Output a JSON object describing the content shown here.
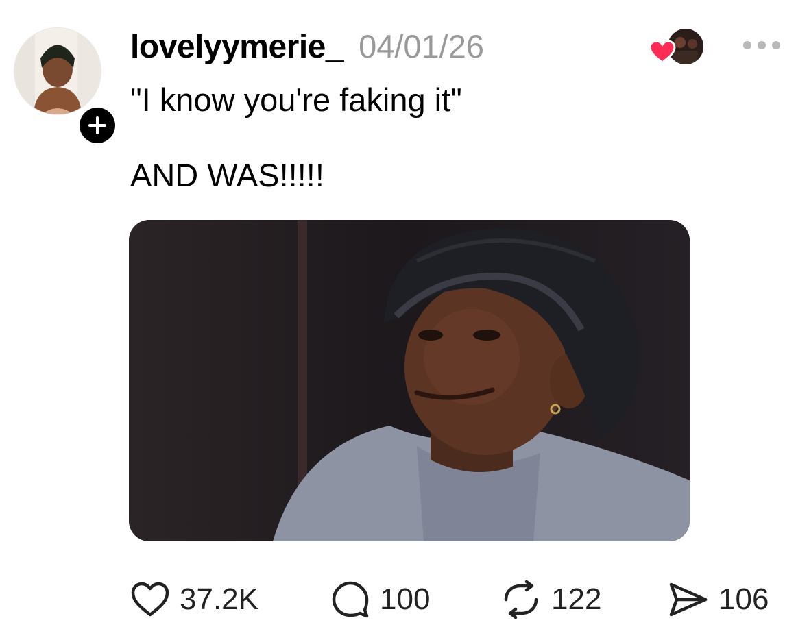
{
  "post": {
    "author": {
      "username": "lovelyymerie_",
      "follow_symbol": "+"
    },
    "timestamp": "04/01/26",
    "text_line1": "\"I know you're faking it\"",
    "text_line2": "AND WAS!!!!!",
    "media": {
      "type": "video-still",
      "icon": "image-media"
    },
    "liked_by": {
      "icon": "heart-icon",
      "color": "#ff2d55"
    },
    "menu": {
      "icon": "more-horizontal-icon"
    },
    "actions": {
      "likes": "37.2K",
      "replies": "100",
      "reposts": "122",
      "shares": "106"
    }
  },
  "colors": {
    "text": "#000000",
    "muted": "#999999",
    "heart": "#ff2d55",
    "background": "#ffffff"
  }
}
